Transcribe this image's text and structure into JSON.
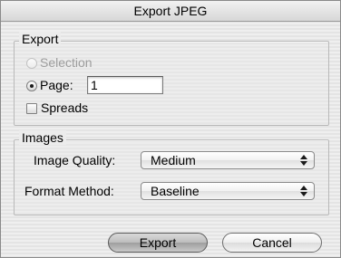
{
  "window": {
    "title": "Export JPEG"
  },
  "export_group": {
    "label": "Export",
    "selection_label": "Selection",
    "page_label": "Page:",
    "page_value": "1",
    "spreads_label": "Spreads"
  },
  "images_group": {
    "label": "Images",
    "quality_label": "Image Quality:",
    "quality_value": "Medium",
    "format_label": "Format Method:",
    "format_value": "Baseline"
  },
  "buttons": {
    "export": "Export",
    "cancel": "Cancel"
  }
}
